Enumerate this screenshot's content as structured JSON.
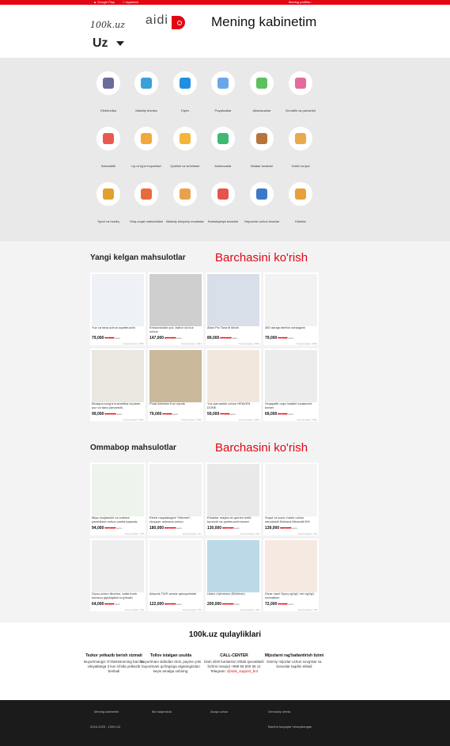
{
  "topbar": {
    "google_play": "Google Play",
    "appstore": "Appstore",
    "profile": "Mening profilim"
  },
  "header": {
    "logo_text": "100k.uz",
    "logo2_text": "aidi",
    "title": "Mening kabinetim",
    "lang": "Uz"
  },
  "categories": [
    {
      "label": "Elektronika",
      "icon": "headphones-icon",
      "color": "#6b6b9e"
    },
    {
      "label": "Maishiy texnika",
      "icon": "fridge-icon",
      "color": "#3aa0d8"
    },
    {
      "label": "Kiyim",
      "icon": "tshirt-icon",
      "color": "#1f8fe0"
    },
    {
      "label": "Poyabzallar",
      "icon": "sneaker-icon",
      "color": "#6aa7e8"
    },
    {
      "label": "Aksessuarlar",
      "icon": "backpack-icon",
      "color": "#5cc05c"
    },
    {
      "label": "Go'zallik va parvarish",
      "icon": "cosmetics-icon",
      "color": "#e36c9d"
    },
    {
      "label": "Salomatlik",
      "icon": "first-aid-icon",
      "color": "#e85a4f"
    },
    {
      "label": "Uy-ro'zg'or buyumlari",
      "icon": "house-icon",
      "color": "#f2a93b"
    },
    {
      "label": "Qurilish va ta'mirlash",
      "icon": "paint-roller-icon",
      "color": "#f5b53a"
    },
    {
      "label": "Avtotovarlar",
      "icon": "car-icon",
      "color": "#3fb873"
    },
    {
      "label": "Bolalar tovarlari",
      "icon": "teddy-bear-icon",
      "color": "#b8743a"
    },
    {
      "label": "Xobbi va ijod",
      "icon": "palette-icon",
      "color": "#e8a94a"
    },
    {
      "label": "Sport va hordiq",
      "icon": "ball-icon",
      "color": "#e0a030"
    },
    {
      "label": "Oziq-ovqat mahsulotlari",
      "icon": "grocery-basket-icon",
      "color": "#e96a3a"
    },
    {
      "label": "Maishiy kimyoviy moddalar",
      "icon": "cleaning-box-icon",
      "color": "#e9a24a"
    },
    {
      "label": "Kanselyariya tovarlari",
      "icon": "notebook-icon",
      "color": "#e6534a"
    },
    {
      "label": "Hayvonlar uchun tovarlar",
      "icon": "pet-food-icon",
      "color": "#3a7ac8"
    },
    {
      "label": "Kitoblar",
      "icon": "books-icon",
      "color": "#e8a03a"
    }
  ],
  "new_products": {
    "title": "Yangi kelgan mahsulotlar",
    "see_all": "Barchasini ko'rish",
    "items": [
      {
        "name": "Yuz va tana uchun oqartiruvchi",
        "price": "79,000",
        "old": "99,000",
        "cur": "so'm",
        "sold": "Sotyotmadan: 2050",
        "img": "cream-bottle-image",
        "bg": "#eef1f5"
      },
      {
        "name": "Krossovkalar yoz, bahor va kuz uchun",
        "price": "147,000",
        "old": "199,000",
        "cur": "so'm",
        "sold": "Sotyotmadan: 3051",
        "img": "sneakers-image",
        "bg": "#cfcfcf"
      },
      {
        "name": "Allan Piz Tana til kitobi",
        "price": "89,000",
        "old": "109,000",
        "cur": "so'm",
        "sold": "Sotyotmadan: 2050",
        "img": "book-image",
        "bg": "#d9dfe8"
      },
      {
        "name": "360 darajа telefon ushlagichi",
        "price": "79,000",
        "old": "99,000",
        "cur": "so'm",
        "sold": "Sotyotmadan: 2050",
        "img": "phone-holder-image",
        "bg": "#f2f2f2"
      },
      {
        "name": "Bioaqua sovg'a kosmetika to'plami, yuz va tana parvarishi,",
        "price": "99,000",
        "old": "149,000",
        "cur": "so'm",
        "sold": "Sotyotmadan: 2051",
        "img": "cosmetic-set-image",
        "bg": "#eae6e0"
      },
      {
        "name": "Pulat Alemdar Kuz oynak",
        "price": "79,000",
        "old": "99,000",
        "cur": "so'm",
        "sold": "Sotyotmadan: 2050",
        "img": "sunglasses-image",
        "bg": "#c9b89a"
      },
      {
        "name": "Yuz parvarishi uchun HEAVEN DONE",
        "price": "59,000",
        "old": "79,000",
        "cur": "so'm",
        "sold": "Sotyotmadan: 2050",
        "img": "serum-bottle-image",
        "bg": "#f1e7dc"
      },
      {
        "name": "Orqapatik orqa holatini tuzatuvchi korset",
        "price": "69,000",
        "old": "89,000",
        "cur": "so'm",
        "sold": "Sotyotmadan: 2050",
        "img": "posture-corrector-image",
        "bg": "#ececec"
      }
    ]
  },
  "popular_products": {
    "title": "Ommabop mahsulotlar",
    "see_all": "Barchasini ko'rish",
    "items": [
      {
        "name": "Miya rivojlanishi va xotirani yaxshilash uchun vosita kapsula,",
        "price": "94,000",
        "old": "119,000",
        "cur": "so'm",
        "sold": "Sotyotmadan: 725",
        "img": "capsule-box-image",
        "bg": "#eef3ee"
      },
      {
        "name": "Elektr maydalagich \"Mixmee\", chopper oshxona uchun",
        "price": "180,000",
        "old": "249,000",
        "cur": "so'm",
        "sold": "Sotyotmadan: 147",
        "img": "chopper-image",
        "bg": "#f0f0f0"
      },
      {
        "name": "Erkaklar mayka isi qornini tortib turuvchi va qoshnuvchi korset",
        "price": "130,000",
        "old": "169,000",
        "cur": "so'm",
        "sold": "Sotyotmadan: 198",
        "img": "shapewear-image",
        "bg": "#e9e9e9"
      },
      {
        "name": "Soqol va soch o'sishi uchun minoksidil Kirkland Minoxidil 5%",
        "price": "139,000",
        "old": "169,000",
        "cur": "so'm",
        "sold": "Sotyotmadan: 168",
        "img": "minoxidil-bottle-image",
        "bg": "#f4f4f4"
      },
      {
        "name": "Oyoq uchun tikuvlon, katta bosh barmoq qiyshiqlikni to'g'rilash",
        "price": "64,000",
        "old": "89,000",
        "cur": "so'm",
        "sold": "Sotyotmadan: 762",
        "img": "toe-corrector-image",
        "bg": "#eeeeee"
      },
      {
        "name": "Airpods TWS simsiz quloqchinlari",
        "price": "122,000",
        "old": "149,000",
        "cur": "so'm",
        "sold": "Sotyotmadan: 755",
        "img": "earbuds-image",
        "bg": "#f5f5f5"
      },
      {
        "name": "Ustoz o'yinamoz (Elektron)",
        "price": "200,000",
        "old": "249,000",
        "cur": "so'm",
        "sold": "Sotyotmadan: 250",
        "img": "kids-mat-image",
        "bg": "#bcd9e8"
      },
      {
        "name": "Dizar mazi Oyoq og'rig'i, bel og'rig'i, revmatizm",
        "price": "72,000",
        "old": "94,000",
        "cur": "so'm",
        "sold": "Sotyotmadan: 709",
        "img": "ointment-box-image",
        "bg": "#f6e9e1"
      }
    ]
  },
  "features": {
    "title": "100k.uz qulayliklari",
    "items": [
      {
        "title": "Tezkor yetkazib berish xizmati",
        "desc": "Buyurtmangiz O'zbekistonning barcha viloyatlariga 3 kun ichida yetkazib beriladi",
        "link": ""
      },
      {
        "title": "Tollov istalgan usulda",
        "desc": "Buyurtmani oldindan click, payme yoki buyurtmani qo'lingizga olganingizdan keyin amalga oshiring.",
        "link": ""
      },
      {
        "title": "CALL-CENTER",
        "desc": "Dam olish kunlarisiz ishlab quvvatlash bo'limi mavjud +998 55 500 55 11 Telegram:",
        "link": "@stok_support_bot"
      },
      {
        "title": "Mijozlarni rag'batlantirish tizimi",
        "desc": "Doimiy mijozlar uchun sovg'alar va bonuslar taqdim etiladi",
        "link": ""
      }
    ]
  },
  "footer": {
    "links": [
      "Mening kabinetim",
      "Biz haqimizda",
      "Aloqa uchun",
      "Ommaviy oferta"
    ],
    "copyright": "2016-2025 - 100K.UZ",
    "rights": "Barcha huquqlar himoyalangan"
  }
}
